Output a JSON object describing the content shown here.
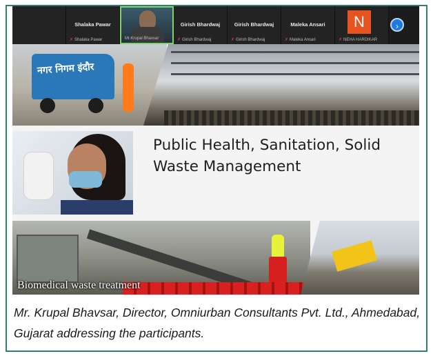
{
  "meeting": {
    "participants": [
      {
        "name": "Shalaka Pawar",
        "sub": "Shalaka Pawar",
        "type": "name"
      },
      {
        "name": "",
        "sub": "Mr.Krupal Bhavsar",
        "type": "video"
      },
      {
        "name": "Girish Bhardwaj",
        "sub": "Girish Bhardwaj",
        "type": "name"
      },
      {
        "name": "Girish Bhardwaj",
        "sub": "Girish Bhardwaj",
        "type": "name"
      },
      {
        "name": "Maleka Ansari",
        "sub": "Maleka Ansari",
        "type": "name"
      },
      {
        "name": "N",
        "sub": "NEHA HARDIKAR",
        "type": "avatar"
      }
    ],
    "next_icon": "chevron-right-icon",
    "avatar_color": "#e8521f"
  },
  "slide": {
    "headline": "Public Health, Sanitation, Solid Waste Management",
    "truck_text": "नगर निगम इंदौर",
    "image_label": "Biomedical waste treatment"
  },
  "caption": "Mr. Krupal Bhavsar, Director, Omniurban Consultants Pvt. Ltd., Ahmedabad, Gujarat addressing the participants.",
  "colors": {
    "border": "#2e7f6e"
  }
}
